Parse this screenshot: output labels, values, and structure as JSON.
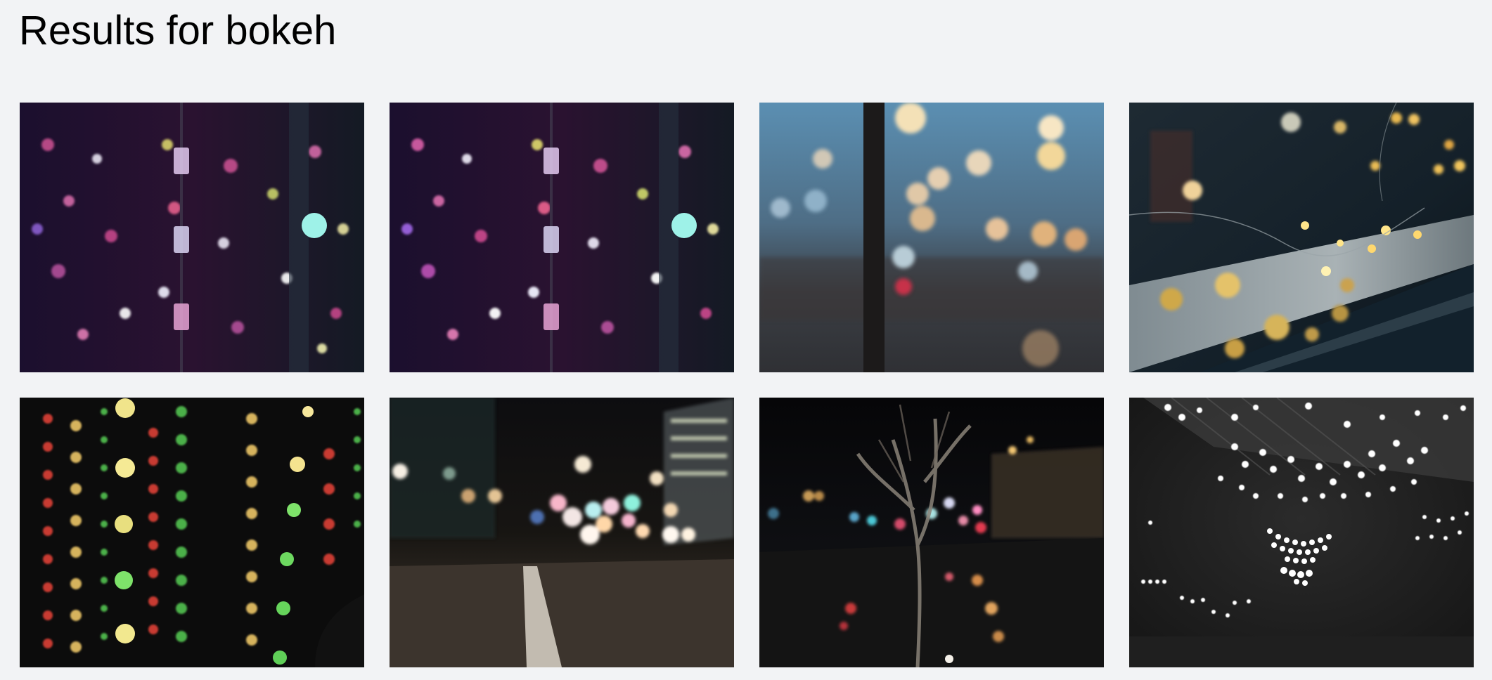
{
  "page": {
    "title": "Results for bokeh"
  },
  "results": [
    {
      "id": 1,
      "scene": "purple-pink bokeh light curtain with crystal beads"
    },
    {
      "id": 2,
      "scene": "purple-pink bokeh light curtain with crystal beads"
    },
    {
      "id": 3,
      "scene": "blue dusk street through window with warm bokeh"
    },
    {
      "id": 4,
      "scene": "fairy lights on a window ledge"
    },
    {
      "id": 5,
      "scene": "red green and yellow bokeh light strands"
    },
    {
      "id": 6,
      "scene": "night road with blurred city lights"
    },
    {
      "id": 7,
      "scene": "rainy night sidewalk with tree"
    },
    {
      "id": 8,
      "scene": "black and white bokeh lights under a canopy"
    }
  ]
}
